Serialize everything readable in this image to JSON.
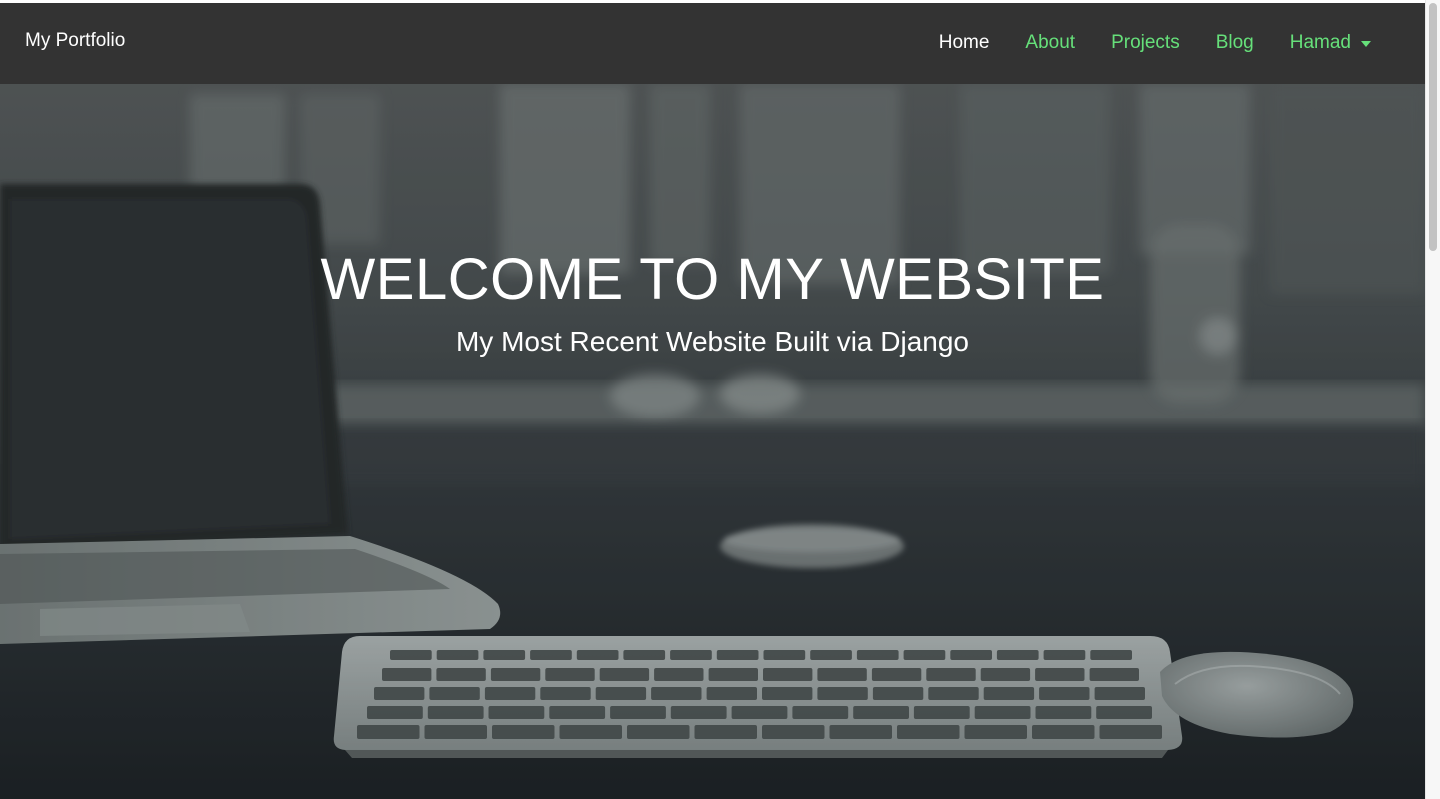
{
  "navbar": {
    "brand": "My Portfolio",
    "links": [
      {
        "label": "Home",
        "active": true
      },
      {
        "label": "About",
        "active": false
      },
      {
        "label": "Projects",
        "active": false
      },
      {
        "label": "Blog",
        "active": false
      },
      {
        "label": "Hamad",
        "active": false,
        "dropdown": true
      }
    ]
  },
  "hero": {
    "title": "WELCOME TO MY WEBSITE",
    "subtitle": "My Most Recent Website Built via Django",
    "background_icon": "desk-photo-laptop-keyboard-mouse"
  },
  "colors": {
    "navbar_bg": "#333333",
    "link_color": "#66e07a",
    "active_link_color": "#ffffff",
    "hero_text": "#ffffff"
  }
}
